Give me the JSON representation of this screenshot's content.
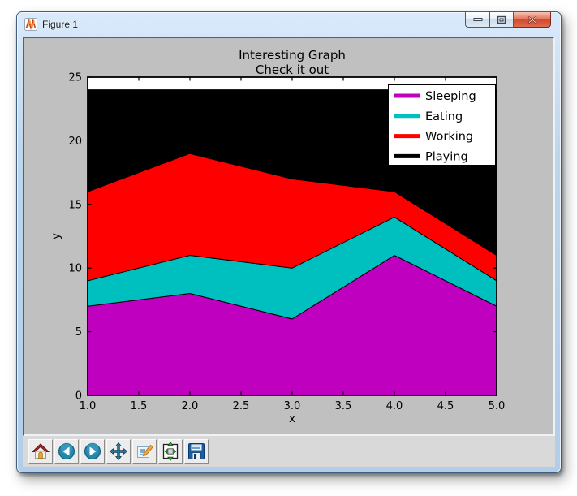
{
  "window": {
    "title": "Figure 1",
    "controls": {
      "minimize": "minimize",
      "maximize": "maximize",
      "close": "close"
    }
  },
  "chart_data": {
    "type": "area",
    "stacked": true,
    "title": "Interesting Graph",
    "subtitle": "Check it out",
    "xlabel": "x",
    "ylabel": "y",
    "x": [
      1,
      2,
      3,
      4,
      5
    ],
    "series": [
      {
        "name": "Sleeping",
        "color": "#bf00bf",
        "values": [
          7,
          8,
          6,
          11,
          7
        ]
      },
      {
        "name": "Eating",
        "color": "#00bfbf",
        "values": [
          2,
          3,
          4,
          3,
          2
        ]
      },
      {
        "name": "Working",
        "color": "#ff0000",
        "values": [
          7,
          8,
          7,
          2,
          2
        ]
      },
      {
        "name": "Playing",
        "color": "#000000",
        "values": [
          8,
          5,
          7,
          8,
          13
        ]
      }
    ],
    "xlim": [
      1,
      5
    ],
    "ylim": [
      0,
      25
    ],
    "xticks": [
      1.0,
      1.5,
      2.0,
      2.5,
      3.0,
      3.5,
      4.0,
      4.5,
      5.0
    ],
    "xtick_labels": [
      "1.0",
      "1.5",
      "2.0",
      "2.5",
      "3.0",
      "3.5",
      "4.0",
      "4.5",
      "5.0"
    ],
    "yticks": [
      0,
      5,
      10,
      15,
      20,
      25
    ],
    "ytick_labels": [
      "0",
      "5",
      "10",
      "15",
      "20",
      "25"
    ],
    "legend": {
      "position": "upper right",
      "entries": [
        "Sleeping",
        "Eating",
        "Working",
        "Playing"
      ]
    },
    "grid": false,
    "plot_bg": "#ffffff",
    "figure_bg": "#c0c0c0"
  },
  "toolbar": {
    "buttons": [
      {
        "name": "home"
      },
      {
        "name": "back"
      },
      {
        "name": "forward"
      },
      {
        "name": "pan"
      },
      {
        "name": "zoom-to-rect"
      },
      {
        "name": "configure-subplots"
      },
      {
        "name": "save"
      }
    ]
  }
}
